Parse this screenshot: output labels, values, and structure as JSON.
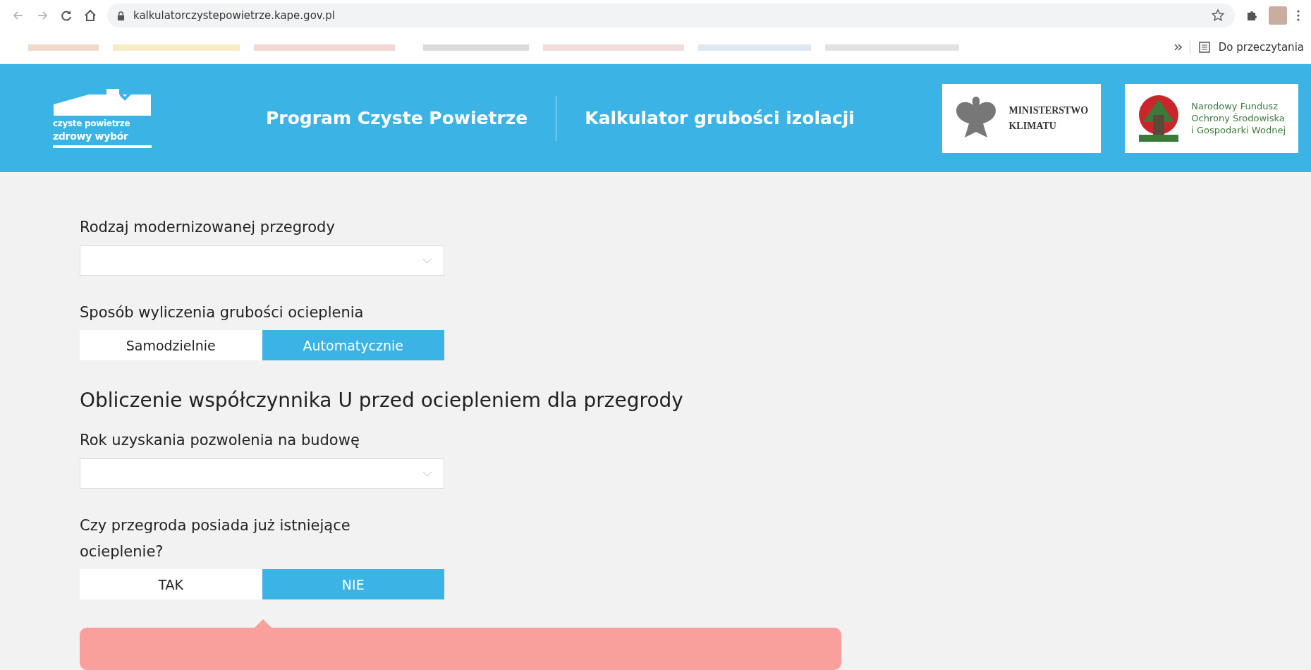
{
  "browser": {
    "url": "kalkulatorczystepowietrze.kape.gov.pl",
    "reading_list": "Do przeczytania"
  },
  "header": {
    "logo_lines": [
      "czyste powietrze",
      "zdrowy wybór"
    ],
    "nav": [
      "Program Czyste Powietrze",
      "Kalkulator grubości izolacji"
    ],
    "ministry": {
      "lines": [
        "MINISTERSTWO",
        "KLIMATU"
      ]
    },
    "fund": {
      "lines": [
        "Narodowy Fundusz",
        "Ochrony Środowiska",
        "i Gospodarki Wodnej"
      ]
    }
  },
  "form": [
    {
      "kind": "select",
      "label": "Rodzaj modernizowanej przegrody"
    },
    {
      "kind": "toggle",
      "label": "Sposób wyliczenia grubości ocieplenia",
      "options": [
        {
          "label": "Samodzielnie",
          "selected": false
        },
        {
          "label": "Automatycznie",
          "selected": true
        }
      ]
    },
    {
      "kind": "heading",
      "label": "Obliczenie współczynnika U przed ociepleniem dla przegrody"
    },
    {
      "kind": "select",
      "label": "Rok uzyskania pozwolenia na budowę"
    },
    {
      "kind": "toggle",
      "label": "Czy przegroda posiada już istniejące ocieplenie?",
      "options": [
        {
          "label": "TAK",
          "selected": false
        },
        {
          "label": "NIE",
          "selected": true
        }
      ]
    },
    {
      "kind": "alert"
    }
  ]
}
